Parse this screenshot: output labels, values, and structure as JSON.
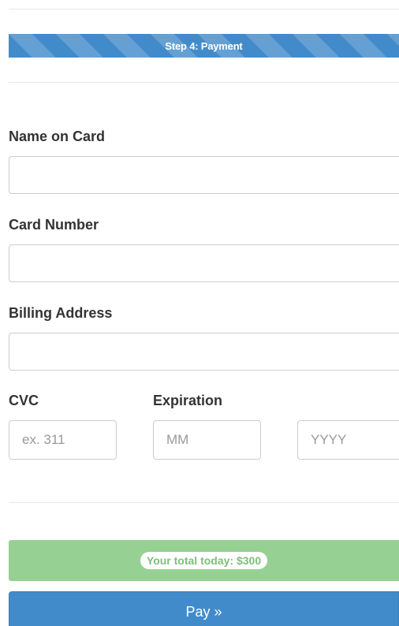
{
  "progress": {
    "label": "Step 4: Payment"
  },
  "form": {
    "name_label": "Name on Card",
    "card_number_label": "Card Number",
    "billing_label": "Billing Address",
    "cvc_label": "CVC",
    "expiration_label": "Expiration",
    "cvc_placeholder": "ex. 311",
    "month_placeholder": "MM",
    "year_placeholder": "YYYY"
  },
  "total": {
    "text": "Your total today: $300"
  },
  "pay": {
    "label": "Pay »"
  },
  "colors": {
    "primary": "#428bca",
    "success": "#96d093"
  }
}
